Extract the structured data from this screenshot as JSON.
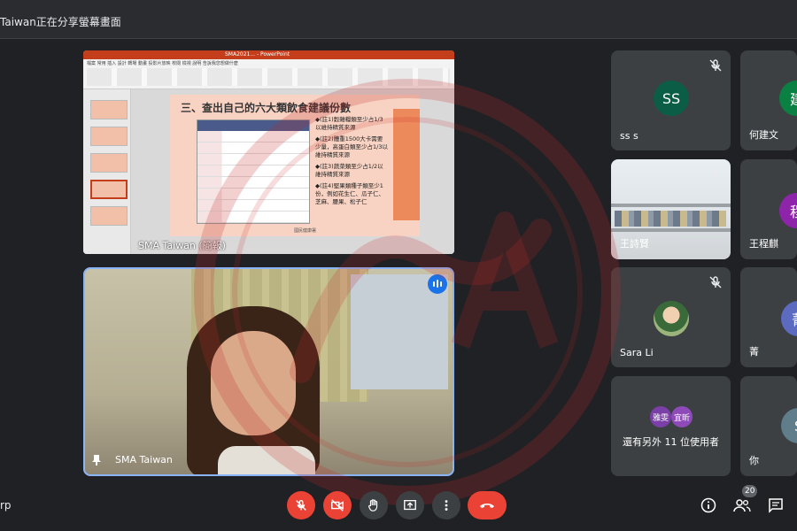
{
  "share_banner": {
    "text": "Taiwan正在分享螢幕畫面"
  },
  "presentation": {
    "window_title": "SMA2021... - PowerPoint",
    "ribbon_tabs": "檔案  常用  插入  設計  轉場  動畫  投影片放映  校閱  檢視  說明    告訴我您想做什麼",
    "slide_title": "三、查出自己的六大類飲食建議份數",
    "bullets": [
      "◆(註1)穀雜糧類至少占1/3以維持精質來源",
      "◆(註2)體重1500大卡需要少量，高蛋白類至少占1/3以維持精質來源",
      "◆(註3)蔬菜類至少占1/2以維持精質來源",
      "◆(註4)堅果類種子類至少1份，例如花生仁、瓜子仁、芝麻、腰果、松子仁"
    ],
    "source_note": "國民健康署",
    "presenter_label": "SMA Taiwan (簡報)"
  },
  "speaker": {
    "name": "SMA Taiwan"
  },
  "participants": [
    {
      "id": "ss",
      "name": "ss s",
      "initials": "SS",
      "avatar_color": "#0b5e45",
      "muted": true
    },
    {
      "id": "he",
      "name": "何建文",
      "initials": "建",
      "avatar_color": "#0b8043",
      "muted": false
    },
    {
      "id": "wang-sx",
      "name": "王詩賢",
      "muted": true
    },
    {
      "id": "wang-cq",
      "name": "王程麒",
      "initials": "程",
      "avatar_color": "#8e24aa",
      "muted": false
    },
    {
      "id": "sara",
      "name": "Sara Li",
      "muted": true
    },
    {
      "id": "jing",
      "name": "菁",
      "initials": "菁",
      "avatar_color": "#5c6bc0",
      "muted": false
    },
    {
      "id": "you",
      "name": "你",
      "initials": "S",
      "avatar_color": "#607d8b",
      "muted": false
    }
  ],
  "others_tile": {
    "avatars": [
      "雅雯",
      "宜昕"
    ],
    "label": "還有另外 11 位使用者"
  },
  "bottom": {
    "meeting_code_fragment": "rp",
    "people_count": "20"
  },
  "colors": {
    "end_red": "#ea4335",
    "accent_blue": "#1a73e8",
    "background": "#202124"
  },
  "icons": [
    "mic-off-icon",
    "camera-off-icon",
    "raise-hand-icon",
    "present-icon",
    "more-options-icon",
    "end-call-icon",
    "info-icon",
    "people-icon",
    "chat-icon"
  ]
}
